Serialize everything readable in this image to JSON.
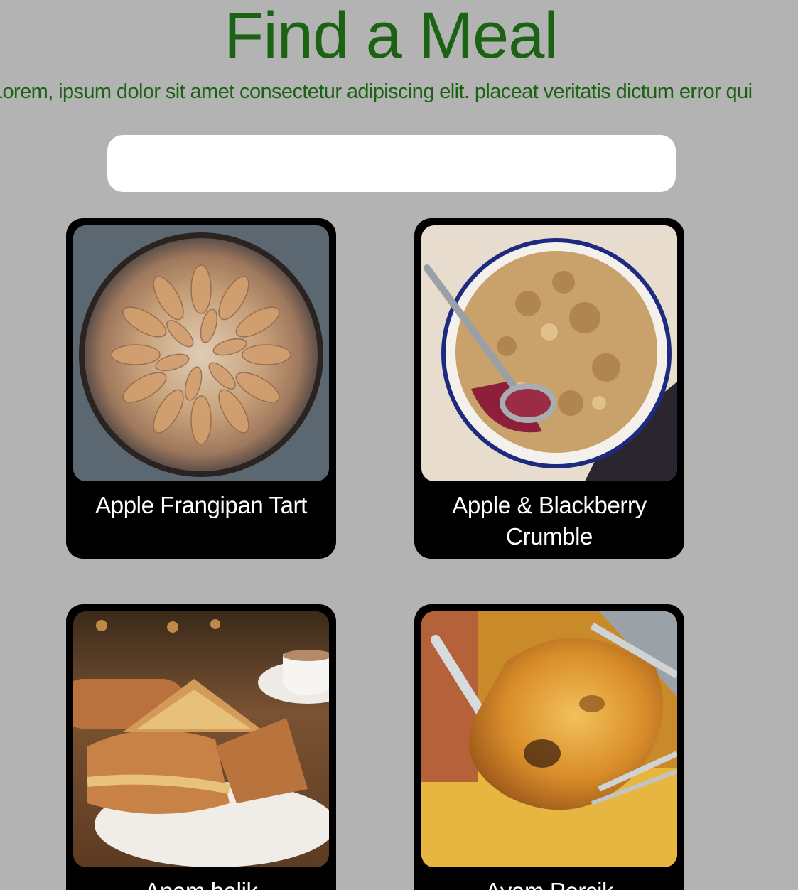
{
  "header": {
    "title": "Find a Meal",
    "tagline": "Lorem, ipsum dolor sit amet consectetur adipiscing elit. placeat veritatis dictum error qui"
  },
  "search": {
    "value": "",
    "placeholder": ""
  },
  "meals": [
    {
      "name": "Apple Frangipan Tart",
      "image": "apple-frangipan-tart-photo"
    },
    {
      "name": "Apple & Blackberry Crumble",
      "image": "apple-blackberry-crumble-photo"
    },
    {
      "name": "Apam balik",
      "image": "apam-balik-photo"
    },
    {
      "name": "Ayam Percik",
      "image": "ayam-percik-photo"
    }
  ],
  "colors": {
    "background": "#b3b3b3",
    "accent_green": "#1a6312",
    "card": "#000000",
    "search_field": "#ffffff"
  }
}
